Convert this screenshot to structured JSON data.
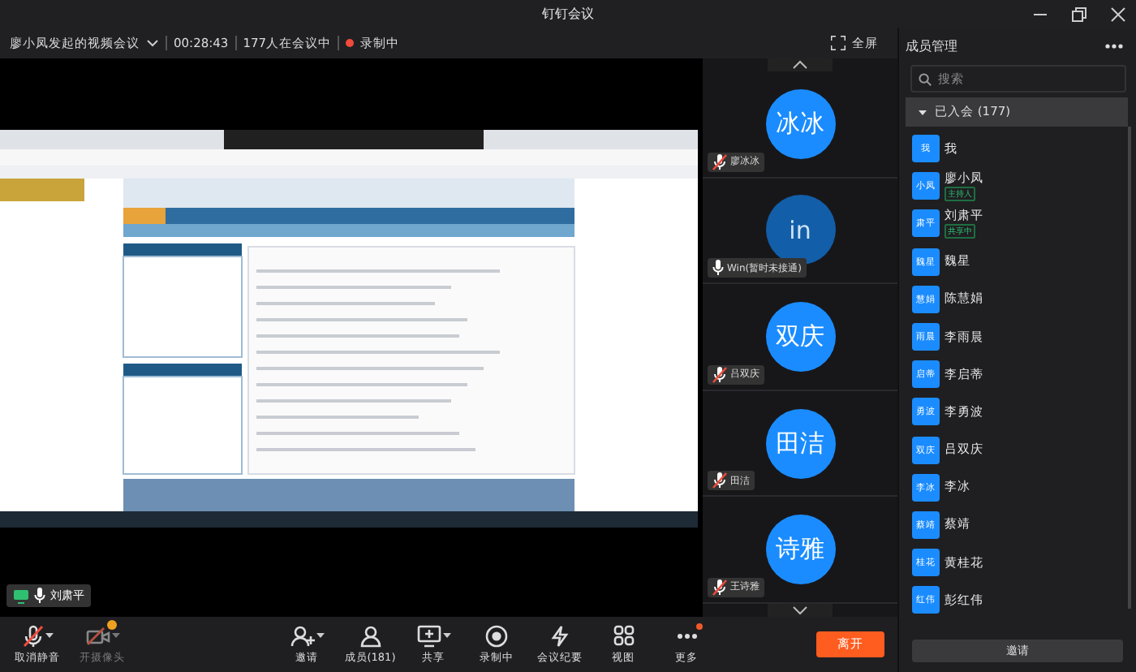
{
  "window": {
    "title": "钉钉会议"
  },
  "meeting_bar": {
    "title": "廖小凤发起的视频会议",
    "duration": "00:28:43",
    "participants": "177人在会议中",
    "recording": "录制中",
    "fullscreen": "全屏"
  },
  "shared_screen": {
    "presenter": "刘肃平"
  },
  "video_tiles": [
    {
      "avatar": "冰冰",
      "name": "廖冰冰",
      "muted": true,
      "connected": true
    },
    {
      "avatar": "in",
      "name": "Win(暂时未接通)",
      "muted": false,
      "connected": false
    },
    {
      "avatar": "双庆",
      "name": "吕双庆",
      "muted": true,
      "connected": true
    },
    {
      "avatar": "田洁",
      "name": "田洁",
      "muted": true,
      "connected": true
    },
    {
      "avatar": "诗雅",
      "name": "王诗雅",
      "muted": true,
      "connected": true
    }
  ],
  "toolbar": {
    "left": [
      {
        "kind": "mic-off",
        "label": "取消静音",
        "caret": true,
        "disabled": false,
        "dot": false
      },
      {
        "kind": "camera",
        "label": "开摄像头",
        "caret": true,
        "disabled": true,
        "dot": true
      }
    ],
    "center": [
      {
        "kind": "invite",
        "label": "邀请",
        "caret": true,
        "disabled": false,
        "dot": false
      },
      {
        "kind": "members",
        "label": "成员(181)",
        "caret": false,
        "disabled": false,
        "dot": false
      },
      {
        "kind": "share",
        "label": "共享",
        "caret": true,
        "disabled": false,
        "dot": false
      },
      {
        "kind": "record",
        "label": "录制中",
        "caret": false,
        "disabled": false,
        "dot": false
      },
      {
        "kind": "minutes",
        "label": "会议纪要",
        "caret": false,
        "disabled": false,
        "dot": false
      },
      {
        "kind": "view",
        "label": "视图",
        "caret": false,
        "disabled": false,
        "dot": false
      },
      {
        "kind": "more",
        "label": "更多",
        "caret": false,
        "disabled": false,
        "dot": true
      }
    ],
    "leave": "离开"
  },
  "members": {
    "title": "成员管理",
    "search_placeholder": "搜索",
    "group": {
      "label": "已入会 (177)",
      "expanded": true
    },
    "items": [
      {
        "avatar": "我",
        "name": "我"
      },
      {
        "avatar": "小凤",
        "name": "廖小凤",
        "tag": "主持人"
      },
      {
        "avatar": "肃平",
        "name": "刘肃平",
        "tag": "共享中"
      },
      {
        "avatar": "魏星",
        "name": "魏星"
      },
      {
        "avatar": "慧娟",
        "name": "陈慧娟"
      },
      {
        "avatar": "雨晨",
        "name": "李雨晨"
      },
      {
        "avatar": "启蒂",
        "name": "李启蒂"
      },
      {
        "avatar": "勇波",
        "name": "李勇波"
      },
      {
        "avatar": "双庆",
        "name": "吕双庆"
      },
      {
        "avatar": "李冰",
        "name": "李冰"
      },
      {
        "avatar": "蔡靖",
        "name": "蔡靖"
      },
      {
        "avatar": "桂花",
        "name": "黄桂花"
      },
      {
        "avatar": "红伟",
        "name": "彭红伟"
      }
    ],
    "invite": "邀请"
  }
}
